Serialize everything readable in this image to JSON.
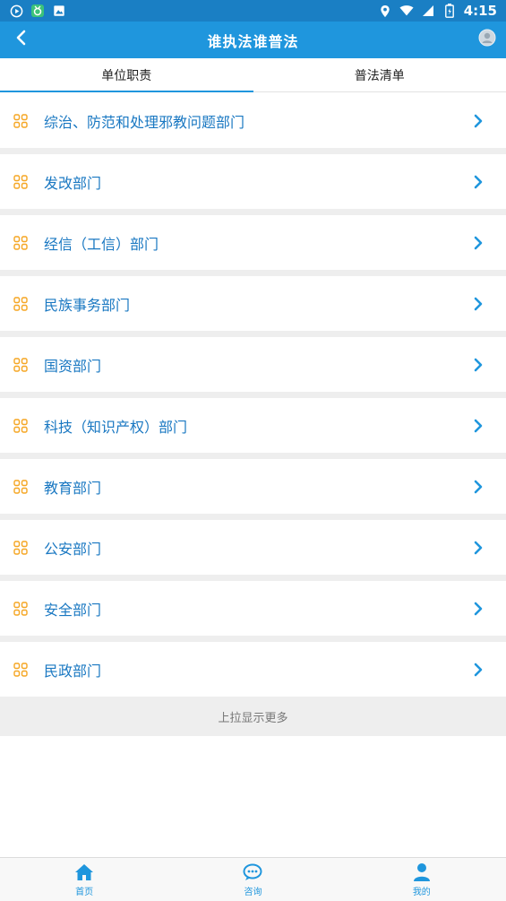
{
  "status_bar": {
    "time": "4:15",
    "icons": [
      "play-circle-icon",
      "app-notification-icon",
      "image-icon",
      "location-icon",
      "wifi-icon",
      "signal-icon",
      "battery-icon"
    ]
  },
  "app_bar": {
    "title": "谁执法谁普法",
    "back_icon": "chevron-left-icon",
    "user_icon": "user-avatar-icon"
  },
  "tabs": [
    {
      "label": "单位职责",
      "active": true
    },
    {
      "label": "普法清单",
      "active": false
    }
  ],
  "list": {
    "items": [
      {
        "label": "综治、防范和处理邪教问题部门"
      },
      {
        "label": "发改部门"
      },
      {
        "label": "经信（工信）部门"
      },
      {
        "label": "民族事务部门"
      },
      {
        "label": "国资部门"
      },
      {
        "label": "科技（知识产权）部门"
      },
      {
        "label": "教育部门"
      },
      {
        "label": "公安部门"
      },
      {
        "label": "安全部门"
      },
      {
        "label": "民政部门"
      }
    ],
    "load_more": "上拉显示更多"
  },
  "bottom_nav": [
    {
      "label": "首页",
      "icon": "home-icon"
    },
    {
      "label": "咨询",
      "icon": "chat-icon"
    },
    {
      "label": "我的",
      "icon": "user-icon"
    }
  ],
  "colors": {
    "status_bar": "#1a7fc4",
    "app_bar": "#1f96dd",
    "item_text": "#1a78c2",
    "item_icon": "#f5a623",
    "chevron": "#1f96dd",
    "background": "#eeeeee"
  }
}
